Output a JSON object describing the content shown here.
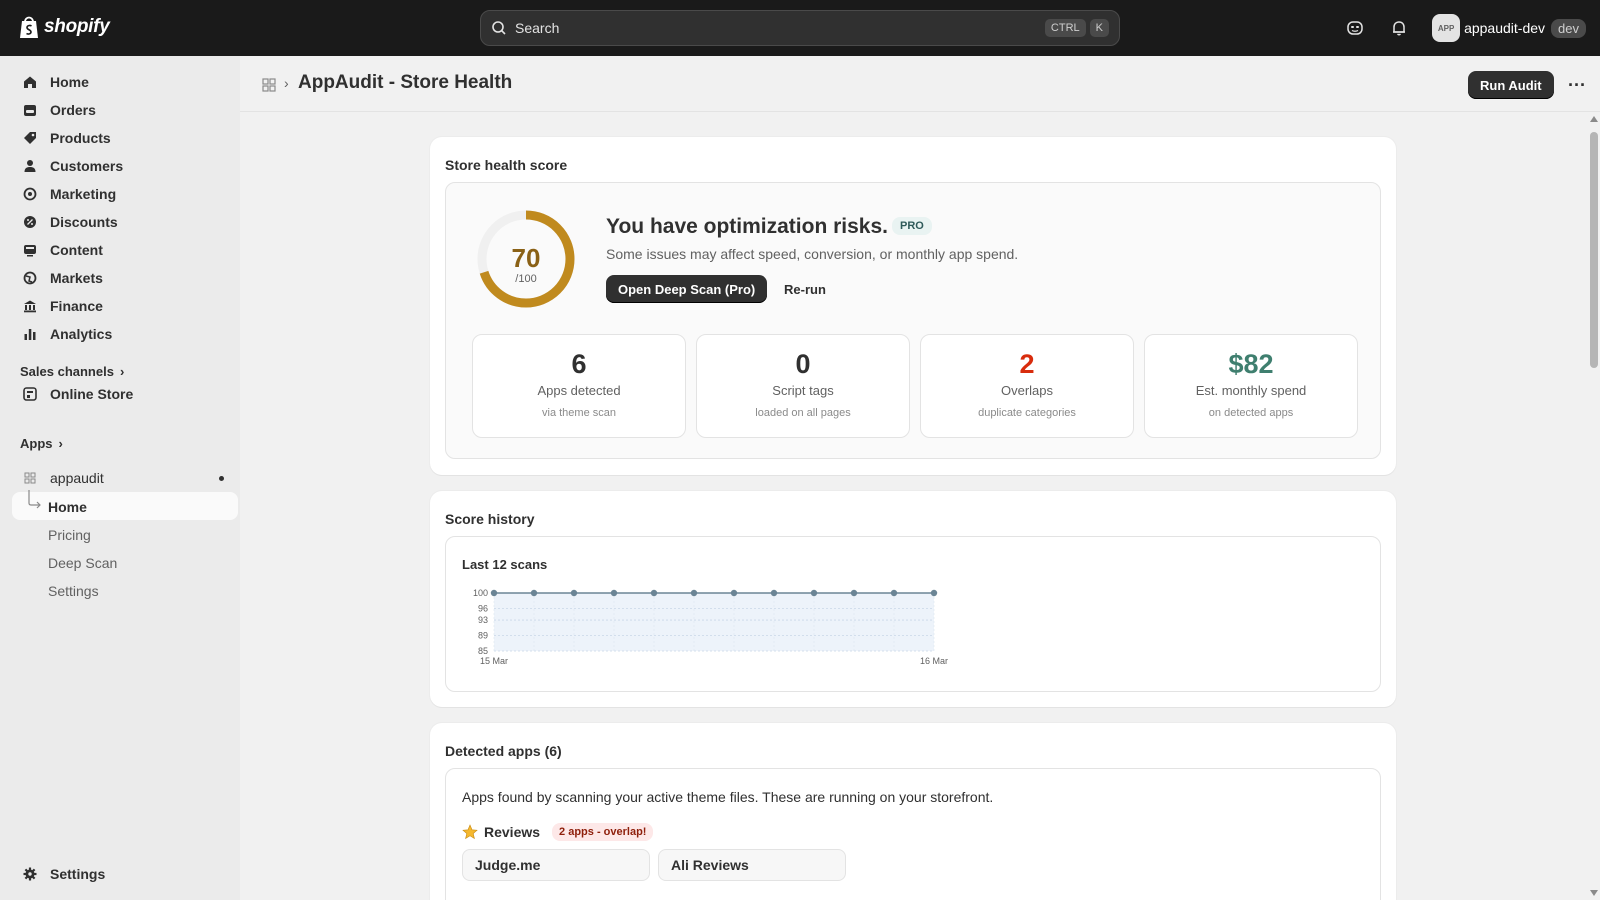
{
  "topbar": {
    "brand": "shopify",
    "search_placeholder": "Search",
    "shortcut_key1": "CTRL",
    "shortcut_key2": "K",
    "user_avatar": "APP",
    "user_name": "appaudit-dev",
    "user_badge": "dev",
    "icons": [
      "shopify-bag-icon",
      "search-icon",
      "assistant-icon",
      "bell-icon"
    ]
  },
  "sidebar": {
    "items": [
      {
        "label": "Home",
        "icon": "home-icon"
      },
      {
        "label": "Orders",
        "icon": "orders-icon"
      },
      {
        "label": "Products",
        "icon": "tag-icon"
      },
      {
        "label": "Customers",
        "icon": "person-icon"
      },
      {
        "label": "Marketing",
        "icon": "target-icon"
      },
      {
        "label": "Discounts",
        "icon": "discount-icon"
      },
      {
        "label": "Content",
        "icon": "content-icon"
      },
      {
        "label": "Markets",
        "icon": "globe-icon"
      },
      {
        "label": "Finance",
        "icon": "bank-icon"
      },
      {
        "label": "Analytics",
        "icon": "chart-icon"
      }
    ],
    "sales_channels_label": "Sales channels",
    "online_store_label": "Online Store",
    "apps_label": "Apps",
    "app_name": "appaudit",
    "app_sub_items": [
      "Home",
      "Pricing",
      "Deep Scan",
      "Settings"
    ],
    "settings_label": "Settings"
  },
  "header": {
    "title": "AppAudit - Store Health",
    "run_button": "Run Audit",
    "more_label": "···"
  },
  "health": {
    "card_title": "Store health score",
    "score": 70,
    "score_display": "70",
    "score_max": "/100",
    "headline": "You have optimization risks.",
    "badge": "PRO",
    "subtext": "Some issues may affect speed, conversion, or monthly app spend.",
    "deep_scan_button": "Open Deep Scan (Pro)",
    "rerun_button": "Re-run",
    "colors": {
      "ring": "#c08a1e",
      "ring_track": "#f0f0f0"
    },
    "stats": [
      {
        "value": "6",
        "label": "Apps detected",
        "sub": "via theme scan",
        "color": "#303030"
      },
      {
        "value": "0",
        "label": "Script tags",
        "sub": "loaded on all pages",
        "color": "#303030"
      },
      {
        "value": "2",
        "label": "Overlaps",
        "sub": "duplicate categories",
        "color": "#d82c0d"
      },
      {
        "value": "$82",
        "label": "Est. monthly spend",
        "sub": "on detected apps",
        "color": "#3f7f6f"
      }
    ]
  },
  "history": {
    "card_title": "Score history",
    "chart_title": "Last 12 scans"
  },
  "chart_data": {
    "type": "line",
    "title": "Last 12 scans",
    "x_labels": [
      "15 Mar",
      "16 Mar"
    ],
    "y_ticks": [
      100,
      96,
      93,
      89,
      85
    ],
    "ylim": [
      85,
      100
    ],
    "series": [
      {
        "values": [
          100,
          100,
          100,
          100,
          100,
          100,
          100,
          100,
          100,
          100,
          100,
          100
        ]
      }
    ],
    "grid": true,
    "colors": {
      "line": "#6b8595",
      "fill": "#e8f0f9"
    }
  },
  "apps": {
    "card_title": "Detected apps (6)",
    "description": "Apps found by scanning your active theme files. These are running on your storefront.",
    "category": "Reviews",
    "category_icon": "star-icon",
    "overlap_badge": "2 apps - overlap!",
    "chips": [
      "Judge.me",
      "Ali Reviews"
    ]
  }
}
